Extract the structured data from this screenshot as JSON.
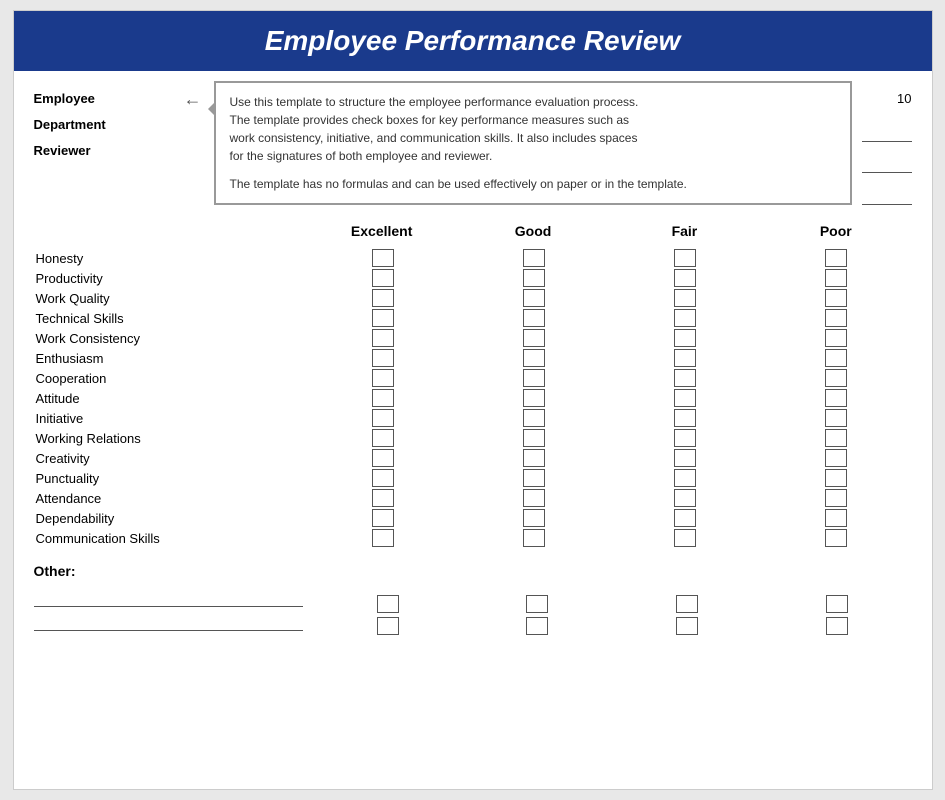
{
  "title": "Employee Performance Review",
  "tooltip": {
    "line1": "Use this template to structure the employee performance evaluation process.",
    "line2": "The template provides check boxes for key performance measures such as",
    "line3": "work consistency, initiative, and communication skills. It also includes spaces",
    "line4": "for the signatures of both employee and reviewer.",
    "line5": "",
    "line6": "The template has no formulas and can be used effectively on paper or in the template."
  },
  "fields": {
    "employee": "Employee",
    "department": "Department",
    "reviewer": "Reviewer"
  },
  "right_number": "10",
  "headers": {
    "excellent": "Excellent",
    "good": "Good",
    "fair": "Fair",
    "poor": "Poor"
  },
  "criteria": [
    "Honesty",
    "Productivity",
    "Work Quality",
    "Technical Skills",
    "Work Consistency",
    "Enthusiasm",
    "Cooperation",
    "Attitude",
    "Initiative",
    "Working Relations",
    "Creativity",
    "Punctuality",
    "Attendance",
    "Dependability",
    "Communication Skills"
  ],
  "other_label": "Other:"
}
